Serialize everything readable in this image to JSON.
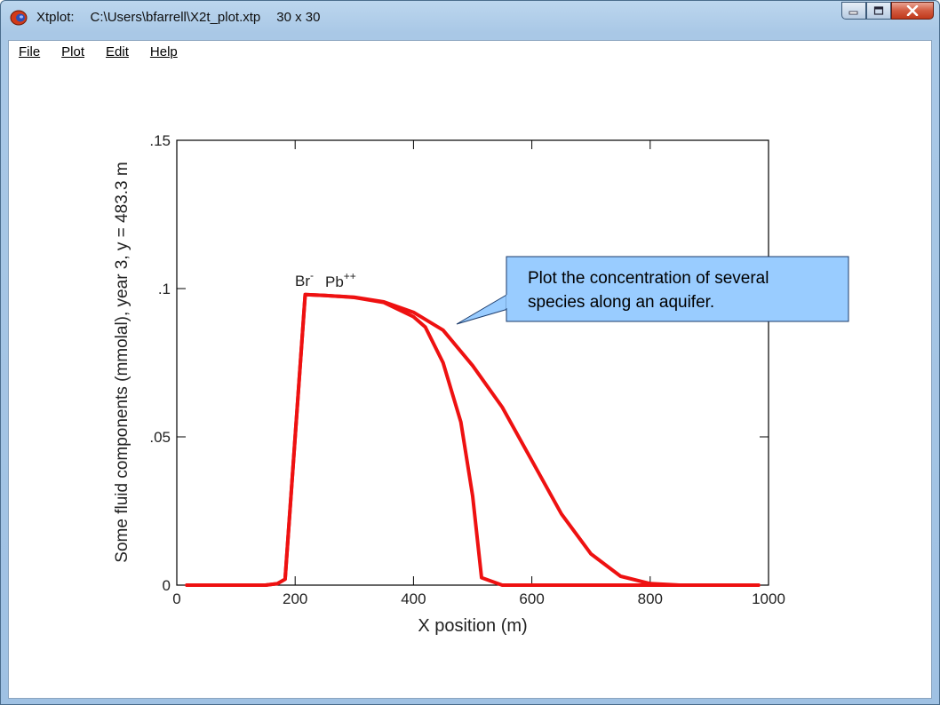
{
  "window": {
    "app_name": "Xtplot:",
    "file_path": "C:\\Users\\bfarrell\\X2t_plot.xtp",
    "grid_size": "30 x 30"
  },
  "menu": {
    "items": [
      {
        "label": "File"
      },
      {
        "label": "Plot"
      },
      {
        "label": "Edit"
      },
      {
        "label": "Help"
      }
    ]
  },
  "callout": {
    "lines": [
      "Plot the concentration of several",
      "species along an aquifer."
    ],
    "background": "#99ccff"
  },
  "chart_data": {
    "type": "line",
    "xlabel": "X position (m)",
    "ylabel": "Some fluid components (mmolal), year 3, y = 483.3 m",
    "xlim": [
      0,
      1000
    ],
    "ylim": [
      0,
      0.15
    ],
    "x_ticks": [
      {
        "value": 0,
        "label": "0"
      },
      {
        "value": 200,
        "label": "200"
      },
      {
        "value": 400,
        "label": "400"
      },
      {
        "value": 600,
        "label": "600"
      },
      {
        "value": 800,
        "label": "800"
      },
      {
        "value": 1000,
        "label": "1000"
      }
    ],
    "y_ticks": [
      {
        "value": 0,
        "label": "0"
      },
      {
        "value": 0.05,
        "label": ".05"
      },
      {
        "value": 0.1,
        "label": ".1"
      },
      {
        "value": 0.15,
        "label": ".15"
      }
    ],
    "line_color": "#ee1111",
    "series": [
      {
        "name": "Br-",
        "label_base": "Br",
        "label_sup": "-",
        "x": [
          17,
          150,
          170,
          183,
          217,
          250,
          300,
          350,
          400,
          450,
          500,
          550,
          600,
          650,
          700,
          750,
          800,
          850,
          900,
          950,
          983
        ],
        "y": [
          0,
          0,
          0.0005,
          0.002,
          0.098,
          0.0977,
          0.0971,
          0.0955,
          0.092,
          0.086,
          0.074,
          0.06,
          0.042,
          0.024,
          0.0105,
          0.003,
          0.0005,
          0,
          0,
          0,
          0
        ]
      },
      {
        "name": "Pb++",
        "label_base": "Pb",
        "label_sup": "++",
        "x": [
          17,
          150,
          170,
          183,
          217,
          250,
          300,
          350,
          400,
          420,
          450,
          480,
          500,
          515,
          550,
          600,
          700,
          800,
          900,
          983
        ],
        "y": [
          0,
          0,
          0.0005,
          0.002,
          0.098,
          0.0977,
          0.097,
          0.0953,
          0.0905,
          0.087,
          0.075,
          0.055,
          0.03,
          0.0025,
          0,
          0,
          0,
          0,
          0,
          0
        ]
      }
    ]
  }
}
